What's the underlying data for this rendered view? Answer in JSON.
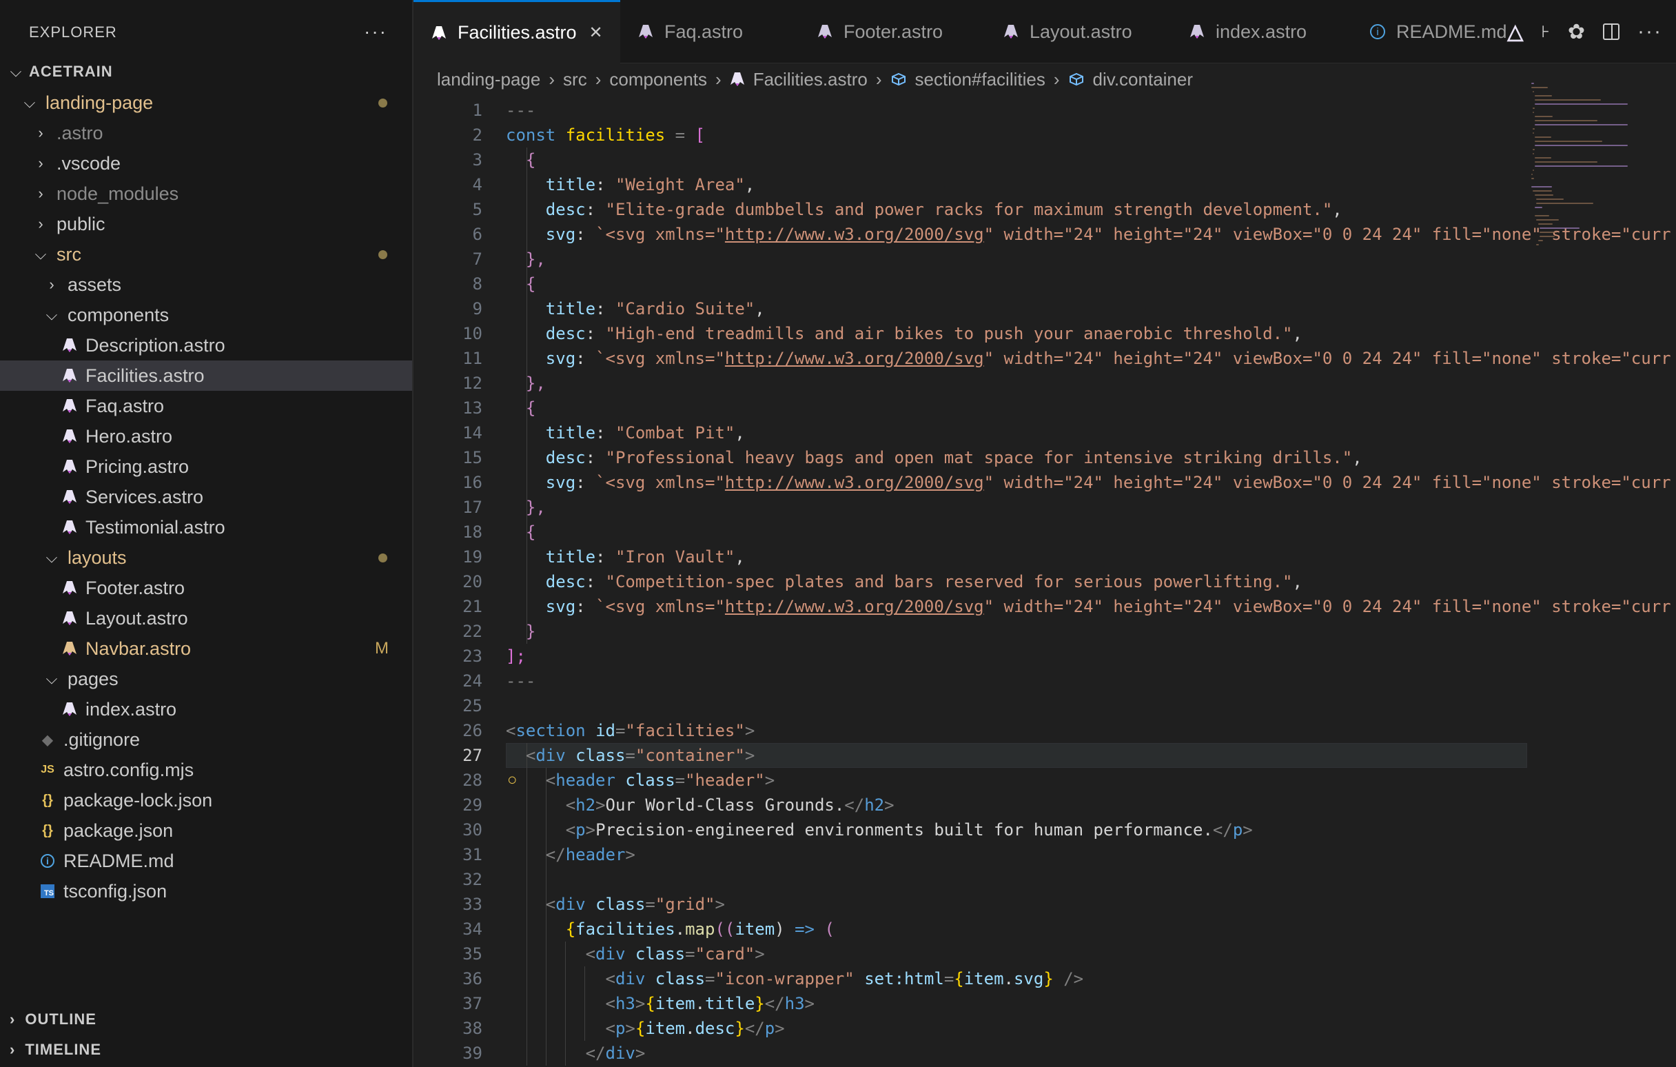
{
  "explorer": {
    "title": "EXPLORER",
    "more_label": "···",
    "workspace": "ACETRAIN",
    "tree": [
      {
        "label": "landing-page",
        "kind": "folder",
        "open": true,
        "depth": 0,
        "style": "mod",
        "dot": true
      },
      {
        "label": ".astro",
        "kind": "folder",
        "open": false,
        "depth": 1,
        "style": "dim"
      },
      {
        "label": ".vscode",
        "kind": "folder",
        "open": false,
        "depth": 1,
        "style": "normal"
      },
      {
        "label": "node_modules",
        "kind": "folder",
        "open": false,
        "depth": 1,
        "style": "dim"
      },
      {
        "label": "public",
        "kind": "folder",
        "open": false,
        "depth": 1,
        "style": "normal"
      },
      {
        "label": "src",
        "kind": "folder",
        "open": true,
        "depth": 1,
        "style": "mod",
        "dot": true
      },
      {
        "label": "assets",
        "kind": "folder",
        "open": false,
        "depth": 2,
        "style": "normal"
      },
      {
        "label": "components",
        "kind": "folder",
        "open": true,
        "depth": 2,
        "style": "normal"
      },
      {
        "label": "Description.astro",
        "kind": "astro",
        "depth": 3,
        "style": "normal"
      },
      {
        "label": "Facilities.astro",
        "kind": "astro",
        "depth": 3,
        "style": "normal",
        "selected": true
      },
      {
        "label": "Faq.astro",
        "kind": "astro",
        "depth": 3,
        "style": "normal"
      },
      {
        "label": "Hero.astro",
        "kind": "astro",
        "depth": 3,
        "style": "normal"
      },
      {
        "label": "Pricing.astro",
        "kind": "astro",
        "depth": 3,
        "style": "normal"
      },
      {
        "label": "Services.astro",
        "kind": "astro",
        "depth": 3,
        "style": "normal"
      },
      {
        "label": "Testimonial.astro",
        "kind": "astro",
        "depth": 3,
        "style": "normal"
      },
      {
        "label": "layouts",
        "kind": "folder",
        "open": true,
        "depth": 2,
        "style": "mod",
        "dot": true
      },
      {
        "label": "Footer.astro",
        "kind": "astro",
        "depth": 3,
        "style": "normal"
      },
      {
        "label": "Layout.astro",
        "kind": "astro",
        "depth": 3,
        "style": "normal"
      },
      {
        "label": "Navbar.astro",
        "kind": "astro",
        "depth": 3,
        "style": "mod",
        "badge": "M"
      },
      {
        "label": "pages",
        "kind": "folder",
        "open": true,
        "depth": 2,
        "style": "normal"
      },
      {
        "label": "index.astro",
        "kind": "astro",
        "depth": 3,
        "style": "normal"
      },
      {
        "label": ".gitignore",
        "kind": "git",
        "depth": 1,
        "style": "normal"
      },
      {
        "label": "astro.config.mjs",
        "kind": "js",
        "depth": 1,
        "style": "normal"
      },
      {
        "label": "package-lock.json",
        "kind": "json",
        "depth": 1,
        "style": "normal"
      },
      {
        "label": "package.json",
        "kind": "json",
        "depth": 1,
        "style": "normal"
      },
      {
        "label": "README.md",
        "kind": "info",
        "depth": 1,
        "style": "normal"
      },
      {
        "label": "tsconfig.json",
        "kind": "ts",
        "depth": 1,
        "style": "normal"
      }
    ],
    "outline_label": "OUTLINE",
    "timeline_label": "TIMELINE"
  },
  "tabs": [
    {
      "label": "Facilities.astro",
      "icon": "astro-icon",
      "active": true
    },
    {
      "label": "Faq.astro",
      "icon": "astro-icon"
    },
    {
      "label": "Footer.astro",
      "icon": "astro-icon"
    },
    {
      "label": "Layout.astro",
      "icon": "astro-icon"
    },
    {
      "label": "index.astro",
      "icon": "astro-icon"
    },
    {
      "label": "README.md",
      "icon": "info-icon"
    }
  ],
  "breadcrumb": [
    {
      "label": "landing-page"
    },
    {
      "label": "src"
    },
    {
      "label": "components"
    },
    {
      "label": "Facilities.astro",
      "icon": "astro-icon"
    },
    {
      "label": "section#facilities",
      "icon": "symbol-icon"
    },
    {
      "label": "div.container",
      "icon": "symbol-icon"
    }
  ],
  "editor": {
    "current_line": 27,
    "first_line": 1,
    "lines": [
      [
        [
          "---",
          "p"
        ]
      ],
      [
        [
          "const ",
          "k"
        ],
        [
          "facilities",
          "y"
        ],
        [
          " = ",
          "p"
        ],
        [
          "[",
          "m"
        ]
      ],
      [
        [
          "  "
        ],
        [
          "{",
          "kc"
        ]
      ],
      [
        [
          "    "
        ],
        [
          "title",
          "v"
        ],
        [
          ": "
        ],
        [
          "\"Weight Area\"",
          "s"
        ],
        [
          ","
        ]
      ],
      [
        [
          "    "
        ],
        [
          "desc",
          "v"
        ],
        [
          ": "
        ],
        [
          "\"Elite-grade dumbbells and power racks for maximum strength development.\"",
          "s"
        ],
        [
          ","
        ]
      ],
      [
        [
          "    "
        ],
        [
          "svg",
          "v"
        ],
        [
          ": "
        ],
        [
          "`<svg xmlns=\"",
          "s"
        ],
        [
          "http://www.w3.org/2000/svg",
          "u"
        ],
        [
          "\" width=\"24\" height=\"24\" viewBox=\"0 0 24 24\" fill=\"none\" stroke=\"curr",
          "s"
        ]
      ],
      [
        [
          "  "
        ],
        [
          "},",
          "kc"
        ]
      ],
      [
        [
          "  "
        ],
        [
          "{",
          "kc"
        ]
      ],
      [
        [
          "    "
        ],
        [
          "title",
          "v"
        ],
        [
          ": "
        ],
        [
          "\"Cardio Suite\"",
          "s"
        ],
        [
          ","
        ]
      ],
      [
        [
          "    "
        ],
        [
          "desc",
          "v"
        ],
        [
          ": "
        ],
        [
          "\"High-end treadmills and air bikes to push your anaerobic threshold.\"",
          "s"
        ],
        [
          ","
        ]
      ],
      [
        [
          "    "
        ],
        [
          "svg",
          "v"
        ],
        [
          ": "
        ],
        [
          "`<svg xmlns=\"",
          "s"
        ],
        [
          "http://www.w3.org/2000/svg",
          "u"
        ],
        [
          "\" width=\"24\" height=\"24\" viewBox=\"0 0 24 24\" fill=\"none\" stroke=\"curr",
          "s"
        ]
      ],
      [
        [
          "  "
        ],
        [
          "},",
          "kc"
        ]
      ],
      [
        [
          "  "
        ],
        [
          "{",
          "kc"
        ]
      ],
      [
        [
          "    "
        ],
        [
          "title",
          "v"
        ],
        [
          ": "
        ],
        [
          "\"Combat Pit\"",
          "s"
        ],
        [
          ","
        ]
      ],
      [
        [
          "    "
        ],
        [
          "desc",
          "v"
        ],
        [
          ": "
        ],
        [
          "\"Professional heavy bags and open mat space for intensive striking drills.\"",
          "s"
        ],
        [
          ","
        ]
      ],
      [
        [
          "    "
        ],
        [
          "svg",
          "v"
        ],
        [
          ": "
        ],
        [
          "`<svg xmlns=\"",
          "s"
        ],
        [
          "http://www.w3.org/2000/svg",
          "u"
        ],
        [
          "\" width=\"24\" height=\"24\" viewBox=\"0 0 24 24\" fill=\"none\" stroke=\"curr",
          "s"
        ]
      ],
      [
        [
          "  "
        ],
        [
          "},",
          "kc"
        ]
      ],
      [
        [
          "  "
        ],
        [
          "{",
          "kc"
        ]
      ],
      [
        [
          "    "
        ],
        [
          "title",
          "v"
        ],
        [
          ": "
        ],
        [
          "\"Iron Vault\"",
          "s"
        ],
        [
          ","
        ]
      ],
      [
        [
          "    "
        ],
        [
          "desc",
          "v"
        ],
        [
          ": "
        ],
        [
          "\"Competition-spec plates and bars reserved for serious powerlifting.\"",
          "s"
        ],
        [
          ","
        ]
      ],
      [
        [
          "    "
        ],
        [
          "svg",
          "v"
        ],
        [
          ": "
        ],
        [
          "`<svg xmlns=\"",
          "s"
        ],
        [
          "http://www.w3.org/2000/svg",
          "u"
        ],
        [
          "\" width=\"24\" height=\"24\" viewBox=\"0 0 24 24\" fill=\"none\" stroke=\"curr",
          "s"
        ]
      ],
      [
        [
          "  "
        ],
        [
          "}",
          "kc"
        ]
      ],
      [
        [
          "];",
          "m"
        ]
      ],
      [
        [
          "---",
          "p"
        ]
      ],
      [
        [
          ""
        ]
      ],
      [
        [
          "<",
          "p"
        ],
        [
          "section",
          "t"
        ],
        [
          " "
        ],
        [
          "id",
          "a"
        ],
        [
          "=",
          "p"
        ],
        [
          "\"facilities\"",
          "s"
        ],
        [
          ">",
          "p"
        ]
      ],
      [
        [
          "  "
        ],
        [
          "<",
          "p"
        ],
        [
          "div",
          "t"
        ],
        [
          " "
        ],
        [
          "class",
          "a"
        ],
        [
          "=",
          "p"
        ],
        [
          "\"container\"",
          "s"
        ],
        [
          ">",
          "p"
        ]
      ],
      [
        [
          "    "
        ],
        [
          "<",
          "p"
        ],
        [
          "header",
          "t"
        ],
        [
          " "
        ],
        [
          "class",
          "a"
        ],
        [
          "=",
          "p"
        ],
        [
          "\"header\"",
          "s"
        ],
        [
          ">",
          "p"
        ]
      ],
      [
        [
          "      "
        ],
        [
          "<",
          "p"
        ],
        [
          "h2",
          "t"
        ],
        [
          ">",
          "p"
        ],
        [
          "Our World-Class Grounds."
        ],
        [
          "</",
          "p"
        ],
        [
          "h2",
          "t"
        ],
        [
          ">",
          "p"
        ]
      ],
      [
        [
          "      "
        ],
        [
          "<",
          "p"
        ],
        [
          "p",
          "t"
        ],
        [
          ">",
          "p"
        ],
        [
          "Precision-engineered environments built for human performance."
        ],
        [
          "</",
          "p"
        ],
        [
          "p",
          "t"
        ],
        [
          ">",
          "p"
        ]
      ],
      [
        [
          "    "
        ],
        [
          "</",
          "p"
        ],
        [
          "header",
          "t"
        ],
        [
          ">",
          "p"
        ]
      ],
      [
        [
          ""
        ]
      ],
      [
        [
          "    "
        ],
        [
          "<",
          "p"
        ],
        [
          "div",
          "t"
        ],
        [
          " "
        ],
        [
          "class",
          "a"
        ],
        [
          "=",
          "p"
        ],
        [
          "\"grid\"",
          "s"
        ],
        [
          ">",
          "p"
        ]
      ],
      [
        [
          "      "
        ],
        [
          "{",
          "y"
        ],
        [
          "facilities",
          "v"
        ],
        [
          "."
        ],
        [
          "map",
          "f"
        ],
        [
          "((",
          "kc"
        ],
        [
          "item",
          "v"
        ],
        [
          ") "
        ],
        [
          "=>",
          "k"
        ],
        [
          " "
        ],
        [
          "(",
          "kc"
        ]
      ],
      [
        [
          "        "
        ],
        [
          "<",
          "p"
        ],
        [
          "div",
          "t"
        ],
        [
          " "
        ],
        [
          "class",
          "a"
        ],
        [
          "=",
          "p"
        ],
        [
          "\"card\"",
          "s"
        ],
        [
          ">",
          "p"
        ]
      ],
      [
        [
          "          "
        ],
        [
          "<",
          "p"
        ],
        [
          "div",
          "t"
        ],
        [
          " "
        ],
        [
          "class",
          "a"
        ],
        [
          "=",
          "p"
        ],
        [
          "\"icon-wrapper\"",
          "s"
        ],
        [
          " "
        ],
        [
          "set:html",
          "a"
        ],
        [
          "=",
          "p"
        ],
        [
          "{",
          "y"
        ],
        [
          "item",
          "v"
        ],
        [
          "."
        ],
        [
          "svg",
          "v"
        ],
        [
          "}",
          "y"
        ],
        [
          " />",
          "p"
        ]
      ],
      [
        [
          "          "
        ],
        [
          "<",
          "p"
        ],
        [
          "h3",
          "t"
        ],
        [
          ">",
          "p"
        ],
        [
          "{",
          "y"
        ],
        [
          "item",
          "v"
        ],
        [
          "."
        ],
        [
          "title",
          "v"
        ],
        [
          "}",
          "y"
        ],
        [
          "</",
          "p"
        ],
        [
          "h3",
          "t"
        ],
        [
          ">",
          "p"
        ]
      ],
      [
        [
          "          "
        ],
        [
          "<",
          "p"
        ],
        [
          "p",
          "t"
        ],
        [
          ">",
          "p"
        ],
        [
          "{",
          "y"
        ],
        [
          "item",
          "v"
        ],
        [
          "."
        ],
        [
          "desc",
          "v"
        ],
        [
          "}",
          "y"
        ],
        [
          "</",
          "p"
        ],
        [
          "p",
          "t"
        ],
        [
          ">",
          "p"
        ]
      ],
      [
        [
          "        "
        ],
        [
          "</",
          "p"
        ],
        [
          "div",
          "t"
        ],
        [
          ">",
          "p"
        ]
      ],
      [
        [
          "      "
        ],
        [
          "))}",
          "y"
        ]
      ]
    ]
  },
  "colors": {
    "accent": "#0078d4",
    "astro": "#e9e3f5",
    "modified": "#e2c08d"
  }
}
